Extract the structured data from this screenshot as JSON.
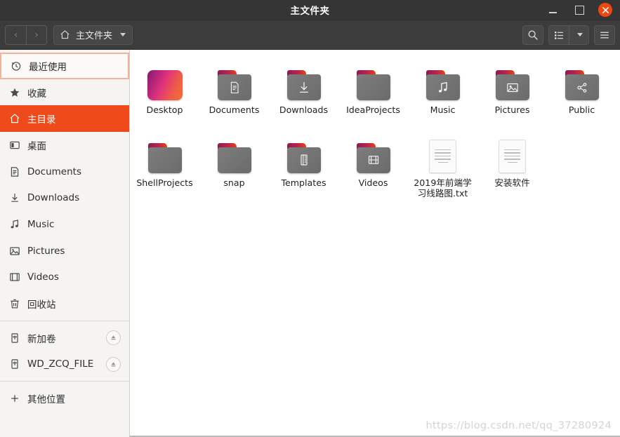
{
  "window": {
    "title": "主文件夹",
    "controls": {
      "minimize": "minimize",
      "maximize": "maximize",
      "close": "close"
    }
  },
  "toolbar": {
    "back": "‹",
    "forward": "›",
    "path_label": "主文件夹",
    "search": "search-icon",
    "view_list": "list-view-icon",
    "view_dropdown": "chevron-down-icon",
    "menu": "hamburger-menu-icon"
  },
  "sidebar": {
    "items": [
      {
        "label": "最近使用",
        "icon": "clock-icon",
        "state": "focused",
        "eject": false
      },
      {
        "label": "收藏",
        "icon": "star-icon",
        "state": "normal",
        "eject": false
      },
      {
        "label": "主目录",
        "icon": "home-icon",
        "state": "selected",
        "eject": false
      },
      {
        "label": "桌面",
        "icon": "desktop-icon",
        "state": "normal",
        "eject": false
      },
      {
        "label": "Documents",
        "icon": "documents-icon",
        "state": "normal",
        "eject": false
      },
      {
        "label": "Downloads",
        "icon": "downloads-icon",
        "state": "normal",
        "eject": false
      },
      {
        "label": "Music",
        "icon": "music-icon",
        "state": "normal",
        "eject": false
      },
      {
        "label": "Pictures",
        "icon": "pictures-icon",
        "state": "normal",
        "eject": false
      },
      {
        "label": "Videos",
        "icon": "videos-icon",
        "state": "normal",
        "eject": false
      },
      {
        "label": "回收站",
        "icon": "trash-icon",
        "state": "normal",
        "eject": false
      },
      {
        "divider": true
      },
      {
        "label": "新加卷",
        "icon": "usb-drive-icon",
        "state": "normal",
        "eject": true
      },
      {
        "label": "WD_ZCQ_FILE",
        "icon": "usb-drive-icon",
        "state": "normal",
        "eject": true
      },
      {
        "divider": true
      },
      {
        "label": "其他位置",
        "icon": "plus-icon",
        "state": "normal",
        "eject": false
      }
    ]
  },
  "main": {
    "rows": [
      [
        {
          "name": "Desktop",
          "type": "folder-gradient",
          "icon": "desktop-folder-icon"
        },
        {
          "name": "Documents",
          "type": "folder",
          "icon": "documents-folder-icon"
        },
        {
          "name": "Downloads",
          "type": "folder",
          "icon": "downloads-folder-icon"
        },
        {
          "name": "IdeaProjects",
          "type": "folder",
          "icon": "plain-folder-icon"
        },
        {
          "name": "Music",
          "type": "folder",
          "icon": "music-folder-icon"
        },
        {
          "name": "Pictures",
          "type": "folder",
          "icon": "pictures-folder-icon"
        },
        {
          "name": "Public",
          "type": "folder",
          "icon": "share-folder-icon"
        }
      ],
      [
        {
          "name": "ShellProjects",
          "type": "folder",
          "icon": "plain-folder-icon"
        },
        {
          "name": "snap",
          "type": "folder",
          "icon": "plain-folder-icon"
        },
        {
          "name": "Templates",
          "type": "folder",
          "icon": "templates-folder-icon"
        },
        {
          "name": "Videos",
          "type": "folder",
          "icon": "videos-folder-icon"
        },
        {
          "name": "2019年前端学习线路图.txt",
          "type": "text-file",
          "icon": "text-file-icon"
        },
        {
          "name": "安装软件",
          "type": "text-file",
          "icon": "text-file-icon"
        }
      ]
    ]
  },
  "watermark": {
    "text": "https://blog.csdn.net/qq_37280924"
  },
  "colors": {
    "accent": "#ef4a1c",
    "titlebar": "#353535",
    "toolbar": "#3c3c3c",
    "sidebar": "#f5f4f2",
    "close_button": "#ee4713"
  }
}
